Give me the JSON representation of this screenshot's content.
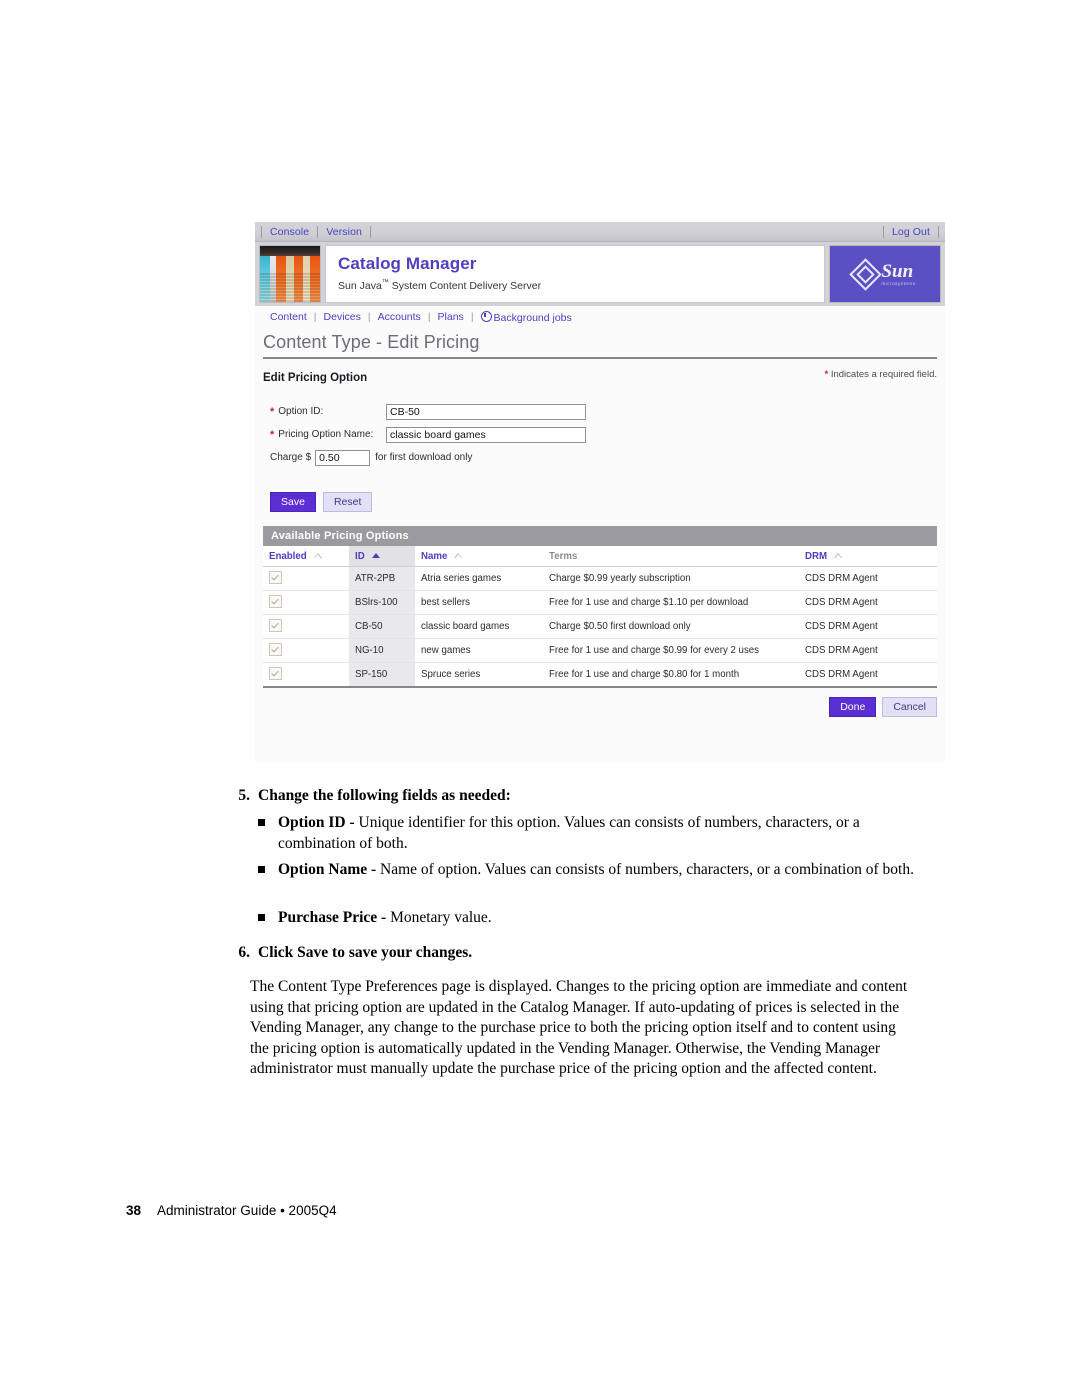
{
  "screenshot": {
    "utility_bar": {
      "left_links": [
        "Console",
        "Version"
      ],
      "right_links": [
        "Log Out"
      ]
    },
    "masthead": {
      "title": "Catalog Manager",
      "subtitle_pre": "Sun Java",
      "subtitle_tm": "™",
      "subtitle_post": " System Content Delivery Server",
      "logo_word": "Sun",
      "logo_micro": "microsystems"
    },
    "nav": {
      "items": [
        "Content",
        "Devices",
        "Accounts",
        "Plans",
        "Background jobs"
      ],
      "separator": "|"
    },
    "page_title": "Content Type - Edit Pricing",
    "form": {
      "section_title": "Edit Pricing Option",
      "required_note": "Indicates a required field.",
      "required_marker": "*",
      "fields": [
        {
          "label": "Option ID:",
          "value": "CB-50",
          "required": true
        },
        {
          "label": "Pricing Option Name:",
          "value": "classic board games",
          "required": true
        }
      ],
      "charge_prefix": "Charge $",
      "charge_value": "0.50",
      "charge_suffix": "for first download only",
      "save_label": "Save",
      "reset_label": "Reset"
    },
    "table": {
      "title": "Available Pricing Options",
      "columns": [
        {
          "label": "Enabled",
          "sort": "hollow"
        },
        {
          "label": "ID",
          "sort": "solid"
        },
        {
          "label": "Name",
          "sort": "hollow"
        },
        {
          "label": "Terms",
          "sort": "none"
        },
        {
          "label": "DRM",
          "sort": "hollow"
        }
      ],
      "rows": [
        {
          "enabled": true,
          "id": "ATR-2PB",
          "name": "Atria series games",
          "terms": "Charge $0.99 yearly subscription",
          "drm": "CDS DRM Agent"
        },
        {
          "enabled": true,
          "id": "BSlrs-100",
          "name": "best sellers",
          "terms": "Free for 1 use and charge $1.10 per download",
          "drm": "CDS DRM Agent"
        },
        {
          "enabled": true,
          "id": "CB-50",
          "name": "classic board games",
          "terms": "Charge $0.50 first download only",
          "drm": "CDS DRM Agent"
        },
        {
          "enabled": true,
          "id": "NG-10",
          "name": "new games",
          "terms": "Free for 1 use and charge $0.99 for every 2 uses",
          "drm": "CDS DRM Agent"
        },
        {
          "enabled": true,
          "id": "SP-150",
          "name": "Spruce series",
          "terms": "Free for 1 use and charge $0.80 for 1 month",
          "drm": "CDS DRM Agent"
        }
      ],
      "done_label": "Done",
      "cancel_label": "Cancel"
    }
  },
  "document": {
    "step5": {
      "number": "5.",
      "text": "Change the following fields as needed:"
    },
    "bullets": [
      {
        "term": "Option ID - ",
        "text": "Unique identifier for this option. Values can consists of numbers, characters, or a combination of both."
      },
      {
        "term": "Option Name - ",
        "text": "Name of option. Values can consists of numbers, characters, or a combination of both."
      },
      {
        "term": "Purchase Price - ",
        "text": "Monetary value."
      }
    ],
    "step6": {
      "number": "6.",
      "text": "Click Save to save your changes."
    },
    "paragraph": "The Content Type Preferences page is displayed. Changes to the pricing option are immediate and content using that pricing option are updated in the Catalog Manager. If auto-updating of prices is selected in the Vending Manager, any change to the purchase price to both the pricing option itself and to content using the pricing option is automatically updated in the Vending Manager. Otherwise, the Vending Manager administrator must manually update the purchase price of the pricing option and the affected content.",
    "footer": {
      "page_number": "38",
      "text": "Administrator Guide • 2005Q4"
    }
  }
}
